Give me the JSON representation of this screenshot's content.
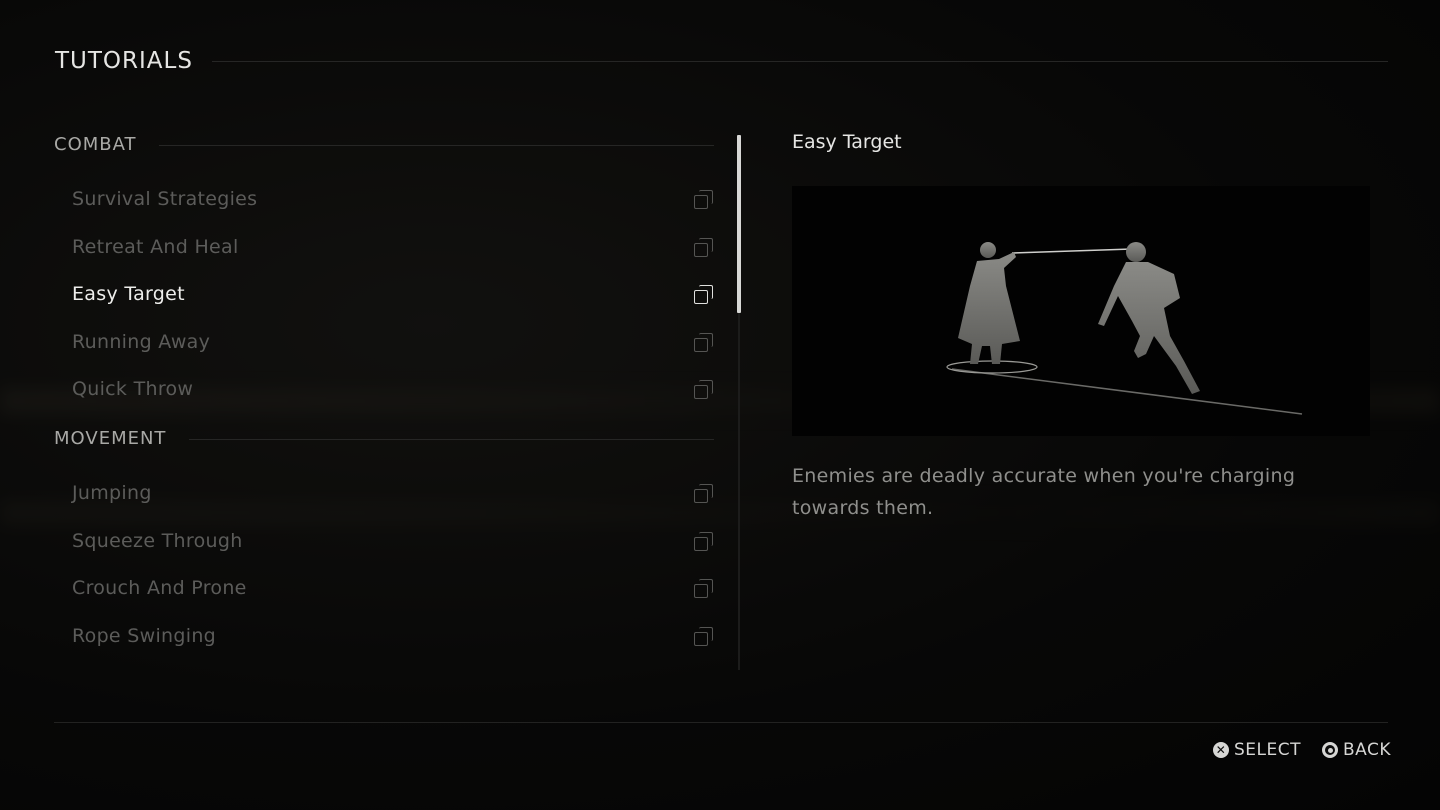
{
  "header": {
    "title": "TUTORIALS"
  },
  "sections": [
    {
      "label": "COMBAT",
      "items": [
        {
          "label": "Survival Strategies",
          "icon": "copy-icon",
          "selected": false
        },
        {
          "label": "Retreat And Heal",
          "icon": "copy-icon",
          "selected": false
        },
        {
          "label": "Easy Target",
          "icon": "copy-icon",
          "selected": true
        },
        {
          "label": "Running Away",
          "icon": "copy-icon",
          "selected": false
        },
        {
          "label": "Quick Throw",
          "icon": "copy-icon",
          "selected": false
        }
      ]
    },
    {
      "label": "MOVEMENT",
      "items": [
        {
          "label": "Jumping",
          "icon": "copy-icon",
          "selected": false
        },
        {
          "label": "Squeeze Through",
          "icon": "copy-icon",
          "selected": false
        },
        {
          "label": "Crouch And Prone",
          "icon": "copy-icon",
          "selected": false
        },
        {
          "label": "Rope Swinging",
          "icon": "copy-icon",
          "selected": false
        }
      ]
    }
  ],
  "detail": {
    "title": "Easy Target",
    "description": "Enemies are deadly accurate when you're charging towards them.",
    "image": "tutorial-illustration-enemy-aiming-at-charging-player"
  },
  "footer": {
    "prompts": [
      {
        "icon": "cross-button-icon",
        "label": "SELECT"
      },
      {
        "icon": "circle-button-icon",
        "label": "BACK"
      }
    ]
  },
  "scroll": {
    "position_fraction": 0.0,
    "visible_fraction": 0.33
  }
}
